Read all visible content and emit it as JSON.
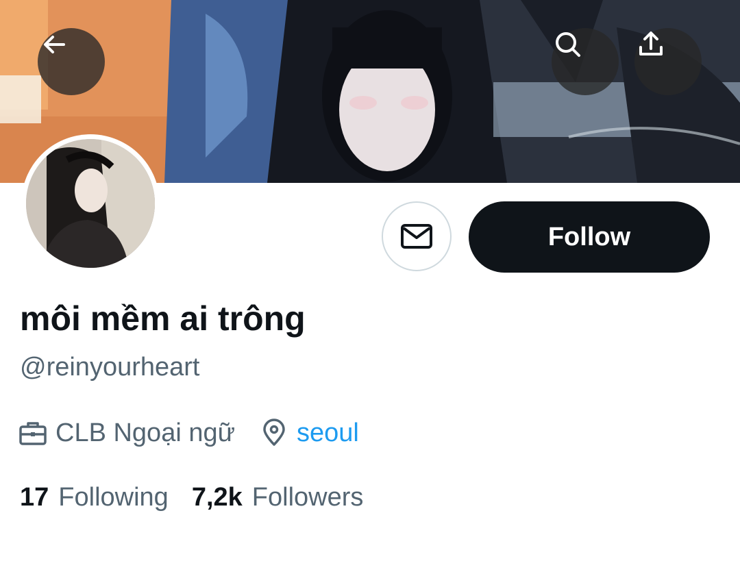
{
  "profile": {
    "display_name": "môi mềm ai trông",
    "handle": "@reinyourheart",
    "work": "CLB Ngoại ngữ",
    "location": "seoul",
    "following_count": "17",
    "following_label": "Following",
    "followers_count": "7,2k",
    "followers_label": "Followers"
  },
  "actions": {
    "follow_label": "Follow",
    "back_icon": "arrow-left-icon",
    "search_icon": "search-icon",
    "share_icon": "share-icon",
    "message_icon": "envelope-icon"
  },
  "colors": {
    "primary_text": "#0f1419",
    "secondary_text": "#536471",
    "link": "#1d9bf0",
    "follow_button_bg": "#0f1419",
    "overlay_button_bg": "#282828"
  }
}
